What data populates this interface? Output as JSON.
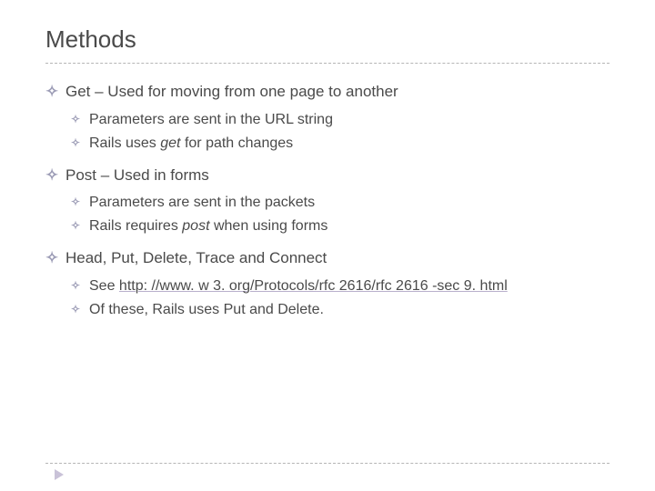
{
  "title": "Methods",
  "bullet": "✧",
  "items": [
    {
      "text": "Get – Used for moving from one page to another",
      "sub": [
        {
          "text": "Parameters are sent in the URL string"
        },
        {
          "pre": "Rails uses ",
          "em": "get",
          "post": " for path changes"
        }
      ]
    },
    {
      "text": "Post – Used in forms",
      "sub": [
        {
          "text": "Parameters are sent in the packets"
        },
        {
          "pre": "Rails requires ",
          "em": "post",
          "post": " when using forms"
        }
      ]
    },
    {
      "text": "Head, Put, Delete, Trace and Connect",
      "sub": [
        {
          "pre": "See ",
          "link": "http: //www. w 3. org/Protocols/rfc 2616/rfc 2616 -sec 9. html"
        },
        {
          "text": "Of these, Rails uses Put and Delete."
        }
      ]
    }
  ]
}
